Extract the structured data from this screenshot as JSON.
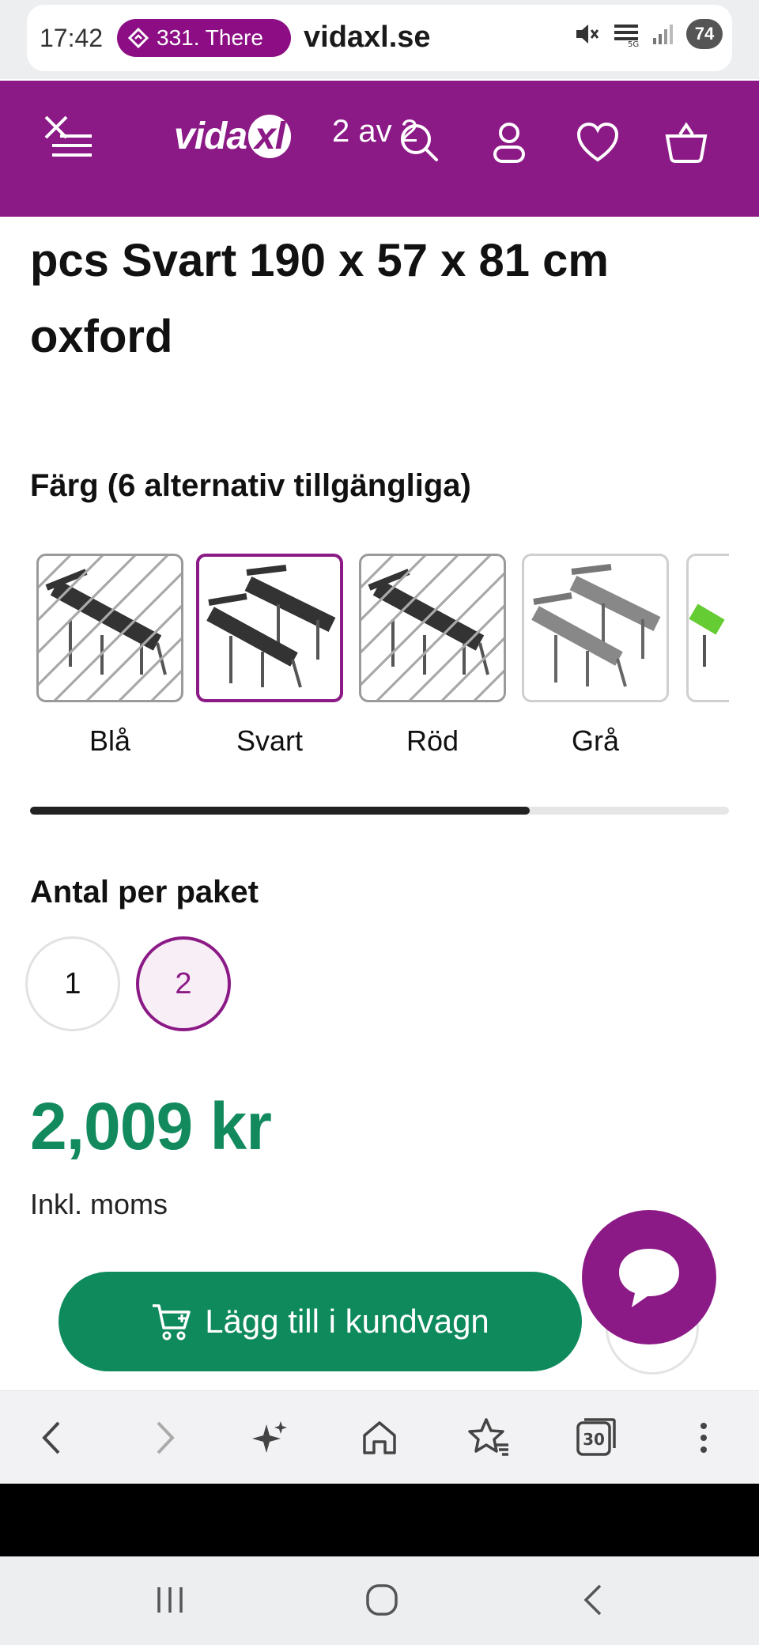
{
  "status_bar": {
    "time": "17:42",
    "notification_pill": "331. There",
    "domain": "vidaxl.se",
    "battery": "74"
  },
  "header": {
    "logo_text": "vida",
    "logo_xl": "xl",
    "page_counter": "2 av 2",
    "brand_color": "#8c1a86"
  },
  "product": {
    "title": "pcs Svart 190 x 57 x 81 cm oxford"
  },
  "color_section": {
    "title": "Färg (6 alternativ tillgängliga)",
    "options": [
      {
        "label": "Blå",
        "available": false,
        "selected": false
      },
      {
        "label": "Svart",
        "available": true,
        "selected": true
      },
      {
        "label": "Röd",
        "available": false,
        "selected": false
      },
      {
        "label": "Grå",
        "available": true,
        "selected": false
      },
      {
        "label": "",
        "available": true,
        "selected": false
      }
    ],
    "scroll_progress": 0.715
  },
  "quantity_section": {
    "title": "Antal per paket",
    "options": [
      "1",
      "2"
    ],
    "selected": "2"
  },
  "price": {
    "amount": "2,009 kr",
    "vat_note": "Inkl. moms",
    "color": "#128a5e"
  },
  "actions": {
    "add_to_cart": "Lägg till i kundvagn"
  },
  "browser_toolbar": {
    "tabs_count": "30"
  }
}
